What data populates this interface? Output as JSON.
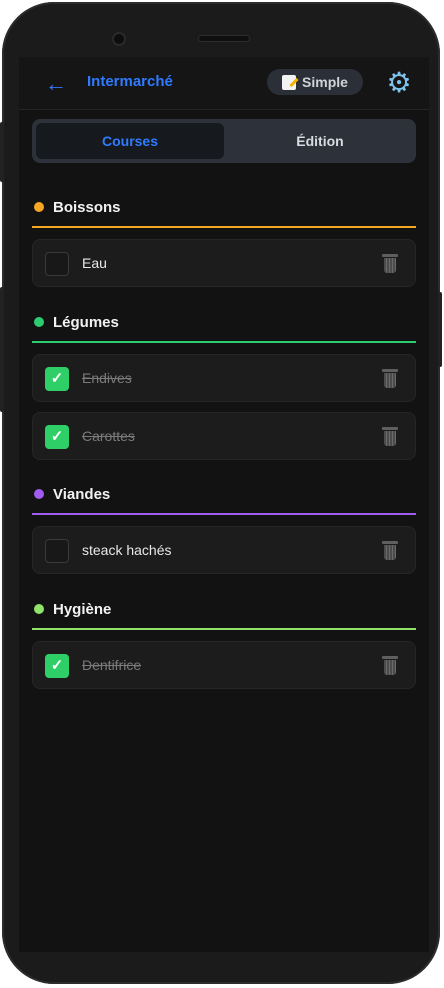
{
  "header": {
    "back_symbol": "←",
    "store_name": "Intermarché",
    "mode_label": "Simple",
    "settings_icon": "gear-icon"
  },
  "tabs": [
    {
      "label": "Courses",
      "active": true
    },
    {
      "label": "Édition",
      "active": false
    }
  ],
  "sections": [
    {
      "title": "Boissons",
      "color": "#f5a623",
      "items": [
        {
          "label": "Eau",
          "checked": false
        }
      ]
    },
    {
      "title": "Légumes",
      "color": "#2ecc71",
      "items": [
        {
          "label": "Endives",
          "checked": true
        },
        {
          "label": "Carottes",
          "checked": true
        }
      ]
    },
    {
      "title": "Viandes",
      "color": "#a05cf0",
      "items": [
        {
          "label": "steack hachés",
          "checked": false
        }
      ]
    },
    {
      "title": "Hygiène",
      "color": "#8fe36a",
      "items": [
        {
          "label": "Dentifrice",
          "checked": true
        }
      ]
    }
  ],
  "checkmark": "✓",
  "colors": {
    "accent": "#2f7bff",
    "check_green": "#2fcf67",
    "background": "#121212"
  }
}
